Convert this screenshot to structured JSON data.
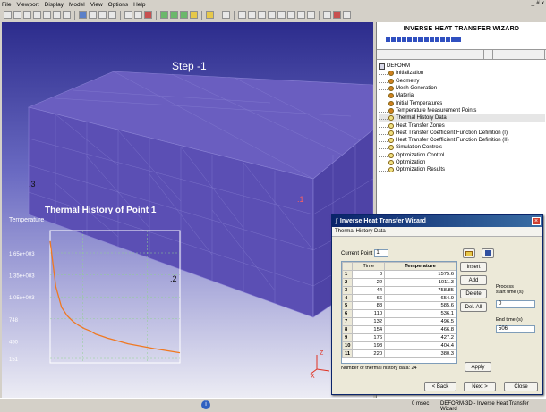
{
  "menubar": {
    "items": [
      "File",
      "Viewport",
      "Display",
      "Model",
      "View",
      "Options",
      "Help"
    ],
    "window_controls": [
      "_",
      "#",
      "x"
    ]
  },
  "viewport": {
    "step_label": "Step   -1",
    "corners": [
      ".3",
      ".1",
      ".2"
    ],
    "axis": {
      "z": "Z",
      "x": "X"
    }
  },
  "chart_data": {
    "type": "line",
    "title": "Thermal History of Point 1",
    "ylabel": "Temperature",
    "yticks": [
      "1.65e+003",
      "1.35e+003",
      "1.05e+003",
      "748",
      "450",
      "151"
    ],
    "ylim": [
      151,
      1650
    ],
    "series": [
      {
        "x": [
          0,
          22,
          44,
          66,
          88,
          110,
          132,
          154,
          176,
          198,
          220,
          300,
          400,
          500
        ],
        "values": [
          1575.6,
          1011.3,
          758.85,
          654.9,
          585.6,
          536.1,
          496.5,
          466.8,
          427.2,
          404.4,
          380.3,
          310,
          250,
          200
        ],
        "color": "#f07820"
      }
    ]
  },
  "wizard": {
    "title": "INVERSE HEAT TRANSFER WIZARD",
    "root": "DEFORM",
    "items": [
      "Initialization",
      "Geometry",
      "Mesh Generation",
      "Material",
      "Initial Temperatures",
      "Temperature Measurement Points",
      "Thermal History Data",
      "Heat Transfer Zones",
      "Heat Transfer Coefficient Function Definition (I)",
      "Heat Transfer Coefficient Function Definition (II)",
      "Simulation Controls",
      "Optimization Control",
      "Optimization",
      "Optimization Results"
    ]
  },
  "dialog": {
    "title": "Inverse Heat Transfer Wizard",
    "subtitle": "Thermal History Data",
    "current_point_label": "Current Point",
    "current_point_value": "1",
    "columns": [
      "Time",
      "Temperature"
    ],
    "rows": [
      [
        "1",
        "0",
        "1575.6"
      ],
      [
        "2",
        "22",
        "1011.3"
      ],
      [
        "3",
        "44",
        "758.85"
      ],
      [
        "4",
        "66",
        "654.9"
      ],
      [
        "5",
        "88",
        "585.6"
      ],
      [
        "6",
        "110",
        "536.1"
      ],
      [
        "7",
        "132",
        "496.5"
      ],
      [
        "8",
        "154",
        "466.8"
      ],
      [
        "9",
        "176",
        "427.2"
      ],
      [
        "10",
        "198",
        "404.4"
      ],
      [
        "11",
        "220",
        "380.3"
      ]
    ],
    "buttons": {
      "insert": "Insert",
      "add": "Add",
      "delete": "Delete",
      "del_all": "Del. All",
      "apply": "Apply",
      "back": "< Back",
      "next": "Next >",
      "close": "Close"
    },
    "process_start_label": "Process\nstart time (s)",
    "process_start_value": "0",
    "end_time_label": "End time (s)",
    "end_time_value": "506",
    "count_text": "Number of thermal history data: 24"
  },
  "status": {
    "time": "0 msec",
    "app": "DEFORM-3D  - Inverse Heat Transfer Wizard"
  }
}
